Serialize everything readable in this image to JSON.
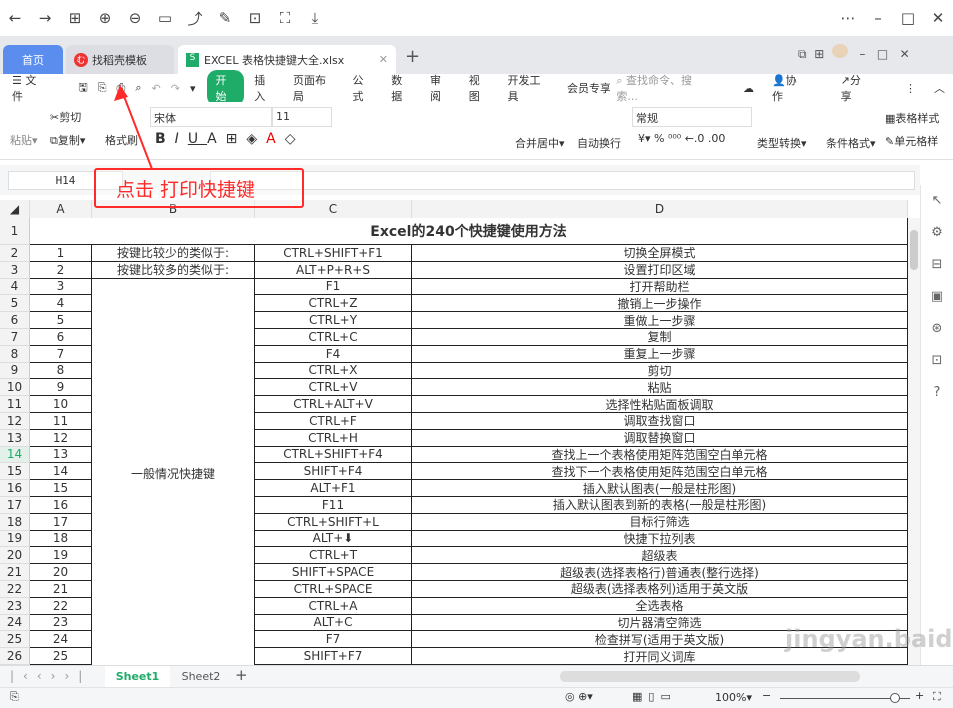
{
  "window": {
    "controls": [
      "more-icon",
      "minimize-icon",
      "maximize-icon",
      "close-icon"
    ]
  },
  "tabs": [
    {
      "label": "首页"
    },
    {
      "label": "找稻壳模板"
    },
    {
      "label": "EXCEL 表格快捷键大全.xlsx"
    }
  ],
  "menu": {
    "file": "文件",
    "items": [
      "开始",
      "插入",
      "页面布局",
      "公式",
      "数据",
      "审阅",
      "视图",
      "开发工具",
      "会员专享"
    ],
    "search_placeholder": "查找命令、搜索...",
    "collab": "协作",
    "share": "分享"
  },
  "ribbon": {
    "paste": "粘贴",
    "cut": "剪切",
    "copy": "复制",
    "format_painter": "格式刷",
    "font": "宋体",
    "size": "11",
    "merge": "合并居中",
    "wrap": "自动换行",
    "number_format": "常规",
    "type_convert": "类型转换",
    "cond_format": "条件格式",
    "table_style": "表格样式",
    "cell_style": "单元格样"
  },
  "formula": {
    "cell_ref": "H14",
    "value": ""
  },
  "annotation": {
    "text": "点击 打印快捷键",
    "color": "#ff2a2a"
  },
  "columns": [
    "A",
    "B",
    "C",
    "D"
  ],
  "sheet": {
    "title": "Excel的240个快捷键使用方法",
    "row2": {
      "a": "1",
      "b": "按键比较少的类似于:",
      "c": "CTRL+SHIFT+F1",
      "d": "切换全屏模式"
    },
    "row3": {
      "a": "2",
      "b": "按键比较多的类似于:",
      "c": "ALT+P+R+S",
      "d": "设置打印区域"
    },
    "merged_b": "一般情况快捷键",
    "rows": [
      [
        "3",
        "F1",
        "打开帮助栏"
      ],
      [
        "4",
        "CTRL+Z",
        "撤销上一步操作"
      ],
      [
        "5",
        "CTRL+Y",
        "重做上一步骤"
      ],
      [
        "6",
        "CTRL+C",
        "复制"
      ],
      [
        "7",
        "F4",
        "重复上一步骤"
      ],
      [
        "8",
        "CTRL+X",
        "剪切"
      ],
      [
        "9",
        "CTRL+V",
        "粘贴"
      ],
      [
        "10",
        "CTRL+ALT+V",
        "选择性粘贴面板调取"
      ],
      [
        "11",
        "CTRL+F",
        "调取查找窗口"
      ],
      [
        "12",
        "CTRL+H",
        "调取替换窗口"
      ],
      [
        "13",
        "CTRL+SHIFT+F4",
        "查找上一个表格使用矩阵范围空白单元格"
      ],
      [
        "14",
        "SHIFT+F4",
        "查找下一个表格使用矩阵范围空白单元格"
      ],
      [
        "15",
        "ALT+F1",
        "插入默认图表(一般是柱形图)"
      ],
      [
        "16",
        "F11",
        "插入默认图表到新的表格(一般是柱形图)"
      ],
      [
        "17",
        "CTRL+SHIFT+L",
        "目标行筛选"
      ],
      [
        "18",
        "ALT+⬇",
        "快捷下拉列表"
      ],
      [
        "19",
        "CTRL+T",
        "超级表"
      ],
      [
        "20",
        "SHIFT+SPACE",
        "超级表(选择表格行)普通表(整行选择)"
      ],
      [
        "21",
        "CTRL+SPACE",
        "超级表(选择表格列)适用于英文版"
      ],
      [
        "22",
        "CTRL+A",
        "全选表格"
      ],
      [
        "23",
        "ALT+C",
        "切片器清空筛选"
      ],
      [
        "24",
        "F7",
        "检查拼写(适用于英文版)"
      ],
      [
        "25",
        "SHIFT+F7",
        "打开同义词库"
      ]
    ]
  },
  "sheets": [
    {
      "label": "Sheet1",
      "active": true
    },
    {
      "label": "Sheet2",
      "active": false
    }
  ],
  "status": {
    "zoom": "100%",
    "zoom_level": 0.5
  },
  "watermark": "jingyan.baidu.com"
}
